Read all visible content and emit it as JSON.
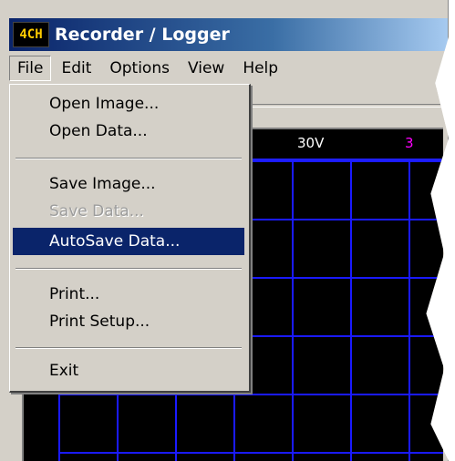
{
  "window": {
    "icon_text": "4CH",
    "title": "Recorder / Logger"
  },
  "menubar": {
    "items": [
      {
        "label": "File"
      },
      {
        "label": "Edit"
      },
      {
        "label": "Options"
      },
      {
        "label": "View"
      },
      {
        "label": "Help"
      }
    ]
  },
  "scope": {
    "scale_labels": [
      {
        "text": "30V"
      },
      {
        "text": "3"
      }
    ]
  },
  "file_menu": {
    "items": [
      {
        "label": "Open Image...",
        "enabled": true
      },
      {
        "label": "Open Data...",
        "enabled": true
      },
      {
        "label": "Save Image...",
        "enabled": true
      },
      {
        "label": "Save Data...",
        "enabled": false
      },
      {
        "label": "AutoSave Data...",
        "enabled": true,
        "highlighted": true
      },
      {
        "label": "Print...",
        "enabled": true
      },
      {
        "label": "Print Setup...",
        "enabled": true
      },
      {
        "label": "Exit",
        "enabled": true
      }
    ]
  },
  "colors": {
    "title_gradient_start": "#0a246a",
    "highlight": "#0a246a",
    "grid": "#1a1aff",
    "scope_bg": "#000000",
    "magenta_label": "#ff00ff"
  }
}
